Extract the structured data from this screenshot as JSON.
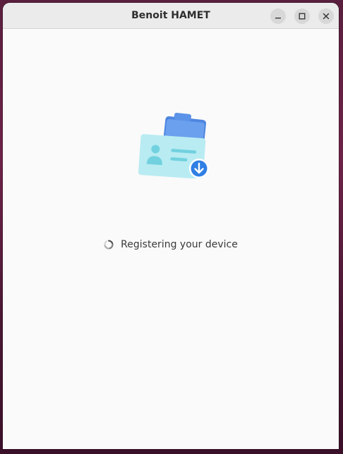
{
  "window": {
    "title": "Benoit HAMET",
    "controls": {
      "minimize_icon": "minimize-icon",
      "maximize_icon": "maximize-icon",
      "close_icon": "close-icon"
    }
  },
  "main": {
    "illustration_icon": "id-card-download-illustration",
    "status": {
      "icon": "loading-spinner-icon",
      "text": "Registering your device"
    }
  },
  "colors": {
    "card_front": "#b8ecf2",
    "card_back": "#5b93e8",
    "download_badge": "#2f7fe4",
    "titlebar": "#ebebeb",
    "content_bg": "#fafafa"
  }
}
